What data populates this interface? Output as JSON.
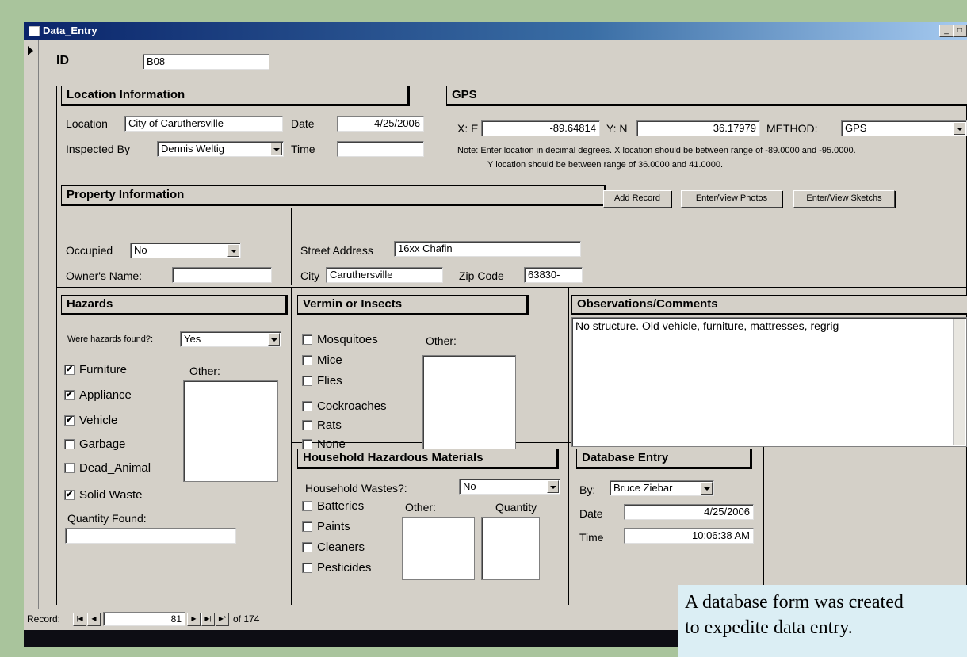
{
  "window": {
    "title": "Data_Entry"
  },
  "id_label": "ID",
  "id_value": "B08",
  "location": {
    "header": "Location Information",
    "location_label": "Location",
    "location_value": "City of Caruthersville",
    "date_label": "Date",
    "date_value": "4/25/2006",
    "inspected_label": "Inspected By",
    "inspected_value": "Dennis Weltig",
    "time_label": "Time",
    "time_value": ""
  },
  "gps": {
    "header": "GPS",
    "x_label": "X: E",
    "x_value": "-89.64814",
    "y_label": "Y: N",
    "y_value": "36.17979",
    "method_label": "METHOD:",
    "method_value": "GPS",
    "note_line1": "Note: Enter location in decimal degrees.  X location should be between range of -89.0000 and -95.0000.",
    "note_line2": "Y location should be between range of 36.0000 and 41.0000."
  },
  "property": {
    "header": "Property Information",
    "occupied_label": "Occupied",
    "occupied_value": "No",
    "owner_label": "Owner's Name:",
    "owner_value": "",
    "street_label": "Street Address",
    "street_value": "16xx Chafin",
    "city_label": "City",
    "city_value": "Caruthersville",
    "zip_label": "Zip Code",
    "zip_value": "63830-"
  },
  "buttons": {
    "add_record": "Add Record",
    "photos": "Enter/View Photos",
    "sketches": "Enter/View Sketchs"
  },
  "hazards": {
    "header": "Hazards",
    "found_label": "Were hazards found?:",
    "found_value": "Yes",
    "other_label": "Other:",
    "items": [
      {
        "label": "Furniture",
        "checked": "✔"
      },
      {
        "label": "Appliance",
        "checked": "✔"
      },
      {
        "label": "Vehicle",
        "checked": "✔"
      },
      {
        "label": "Garbage",
        "checked": ""
      },
      {
        "label": "Dead_Animal",
        "checked": ""
      },
      {
        "label": "Solid Waste",
        "checked": "✔"
      }
    ],
    "quantity_label": "Quantity Found:"
  },
  "vermin": {
    "header": "Vermin or Insects",
    "other_label": "Other:",
    "items": [
      "Mosquitoes",
      "Mice",
      "Flies",
      "Cockroaches",
      "Rats",
      "None"
    ]
  },
  "observations": {
    "header": "Observations/Comments",
    "text": "No structure. Old vehicle, furniture, mattresses, regrig"
  },
  "household": {
    "header": "Household Hazardous Materials",
    "wastes_label": "Household Wastes?:",
    "wastes_value": "No",
    "other_label": "Other:",
    "quantity_label": "Quantity",
    "items": [
      "Batteries",
      "Paints",
      "Cleaners",
      "Pesticides"
    ]
  },
  "db_entry": {
    "header": "Database Entry",
    "by_label": "By:",
    "by_value": "Bruce Ziebar",
    "date_label": "Date",
    "date_value": "4/25/2006",
    "time_label": "Time",
    "time_value": "10:06:38 AM"
  },
  "navigation": {
    "record_label": "Record:",
    "record_value": "81",
    "of_text": "of 174"
  },
  "caption": {
    "line1": "A database form was created",
    "line2": "to expedite data entry."
  }
}
